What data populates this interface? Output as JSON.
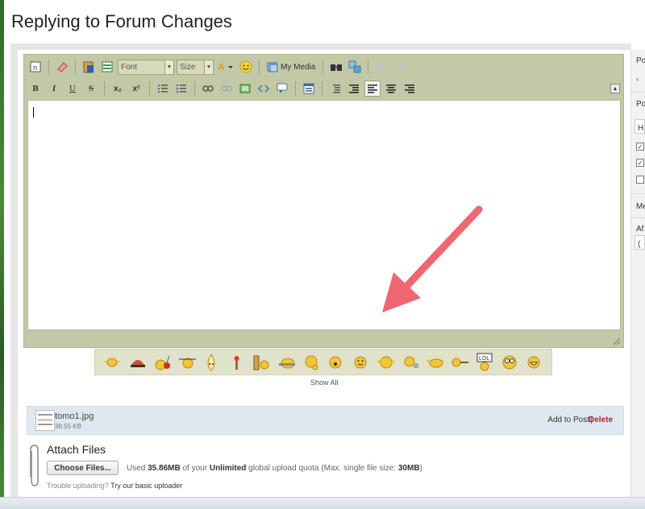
{
  "page": {
    "title": "Replying to Forum Changes"
  },
  "toolbar": {
    "font_label": "Font",
    "size_label": "Size",
    "media_label": "My Media",
    "row1_icons": [
      "source-icon",
      "eraser-icon",
      "paste-word-icon",
      "paste-text-icon"
    ],
    "row2_icons": [
      "bold-icon",
      "italic-icon",
      "underline-icon",
      "strike-icon",
      "subscript-icon",
      "superscript-icon",
      "ordered-list-icon",
      "unordered-list-icon",
      "link-icon",
      "unlink-icon",
      "image-icon",
      "code-icon",
      "quote-icon",
      "table-icon",
      "outdent-icon",
      "indent-icon",
      "align-left-icon",
      "align-center-icon",
      "align-right-icon"
    ],
    "bold": "B",
    "italic": "I",
    "underline": "U",
    "strike": "S",
    "subscript": "x₂",
    "superscript": "x²"
  },
  "smilies": {
    "show_all": "Show All",
    "icons": [
      "smiley-sign-icon",
      "smiley-redhat-icon",
      "smiley-bomb-icon",
      "smiley-arrows-icon",
      "smiley-drop-icon",
      "smiley-torch-icon",
      "smiley-ruler-icon",
      "smiley-sweat-icon",
      "smiley-think-icon",
      "smiley-eek-icon",
      "smiley-plain-icon",
      "smiley-stretch-icon",
      "smiley-wave-icon",
      "smiley-dance-icon",
      "smiley-key-icon",
      "smiley-lol-icon",
      "smiley-glasses-icon",
      "smiley-grin-icon"
    ],
    "lol_text": "LOL"
  },
  "attachment": {
    "file_name": "tomo1.jpg",
    "file_size": "38.55 KB",
    "add_to_post": "Add to Post",
    "separator": "|",
    "delete": "Delete"
  },
  "attach": {
    "title": "Attach Files",
    "choose_button": "Choose Files...",
    "quota_prefix": "Used ",
    "quota_used": "35.86MB",
    "quota_mid": " of your ",
    "quota_plan": "Unlimited",
    "quota_suffix": " global upload quota (Max. single file size: ",
    "quota_max": "30MB",
    "quota_end": ")",
    "trouble_prefix": "Trouble uploading? ",
    "trouble_link": "Try our basic uploader"
  },
  "right_column": {
    "heading1": "Po",
    "heading2": "Po",
    "input_value": "H",
    "heading3": "Me",
    "heading4": "Af",
    "paren": "(",
    "check1": true,
    "check2": true,
    "check3": false
  },
  "colors": {
    "toolbar_bg": "#c3c8a6",
    "arrow": "#f0676f",
    "attach_row_bg": "#dfe8f1",
    "delete_color": "#b22222"
  }
}
